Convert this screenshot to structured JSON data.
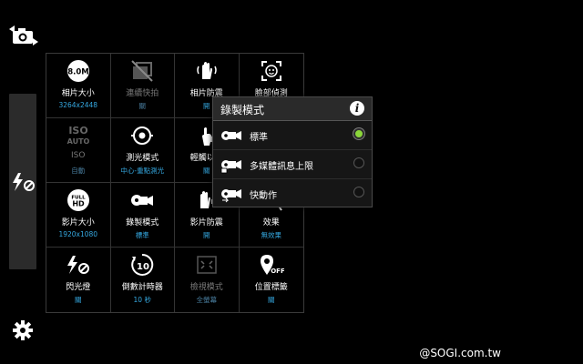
{
  "sidebar": {
    "icons": [
      "switch-camera-icon",
      "flash-off-icon",
      "gear-icon"
    ]
  },
  "grid": {
    "cells": [
      {
        "label": "相片大小",
        "value": "3264x2448",
        "icon": "photo-size-8m-icon",
        "badge": "8.0M"
      },
      {
        "label": "連續快拍",
        "value": "關",
        "icon": "burst-shot-icon",
        "dim": true
      },
      {
        "label": "相片防震",
        "value": "開",
        "icon": "anti-shake-hand-icon"
      },
      {
        "label": "臉部偵測",
        "value": "",
        "icon": "face-detection-icon"
      },
      {
        "label": "ISO",
        "value": "自動",
        "icon": "iso-auto-icon",
        "badge": "ISO AUTO",
        "dim": true
      },
      {
        "label": "測光模式",
        "value": "中心-重點測光",
        "icon": "metering-icon"
      },
      {
        "label": "輕觸以拍",
        "value": "關",
        "icon": "tap-to-shoot-icon"
      },
      {
        "label": "",
        "value": "",
        "icon": "hidden-cell"
      },
      {
        "label": "影片大小",
        "value": "1920x1080",
        "icon": "video-size-fullhd-icon",
        "badge": "FULL HD"
      },
      {
        "label": "錄製模式",
        "value": "標準",
        "icon": "recording-mode-icon"
      },
      {
        "label": "影片防震",
        "value": "開",
        "icon": "video-stabilization-icon"
      },
      {
        "label": "效果",
        "value": "無效果",
        "icon": "effects-icon"
      },
      {
        "label": "閃光燈",
        "value": "關",
        "icon": "flash-off-icon"
      },
      {
        "label": "倒數計時器",
        "value": "10 秒",
        "icon": "timer-10-icon"
      },
      {
        "label": "檢視模式",
        "value": "全螢幕",
        "icon": "view-mode-icon",
        "dim": true
      },
      {
        "label": "位置標籤",
        "value": "關",
        "icon": "location-tag-off-icon"
      }
    ]
  },
  "popup": {
    "title": "錄製模式",
    "info_icon": "info-icon",
    "options": [
      {
        "label": "標準",
        "selected": true,
        "icon": "video-standard-icon"
      },
      {
        "label": "多媒體訊息上限",
        "selected": false,
        "icon": "video-mms-icon"
      },
      {
        "label": "快動作",
        "selected": false,
        "icon": "video-fast-motion-icon"
      }
    ],
    "selected_color": "#8bd63a"
  },
  "watermark": "@SOGI.com.tw",
  "colors": {
    "value_text": "#35a8e0",
    "background": "#000000"
  }
}
